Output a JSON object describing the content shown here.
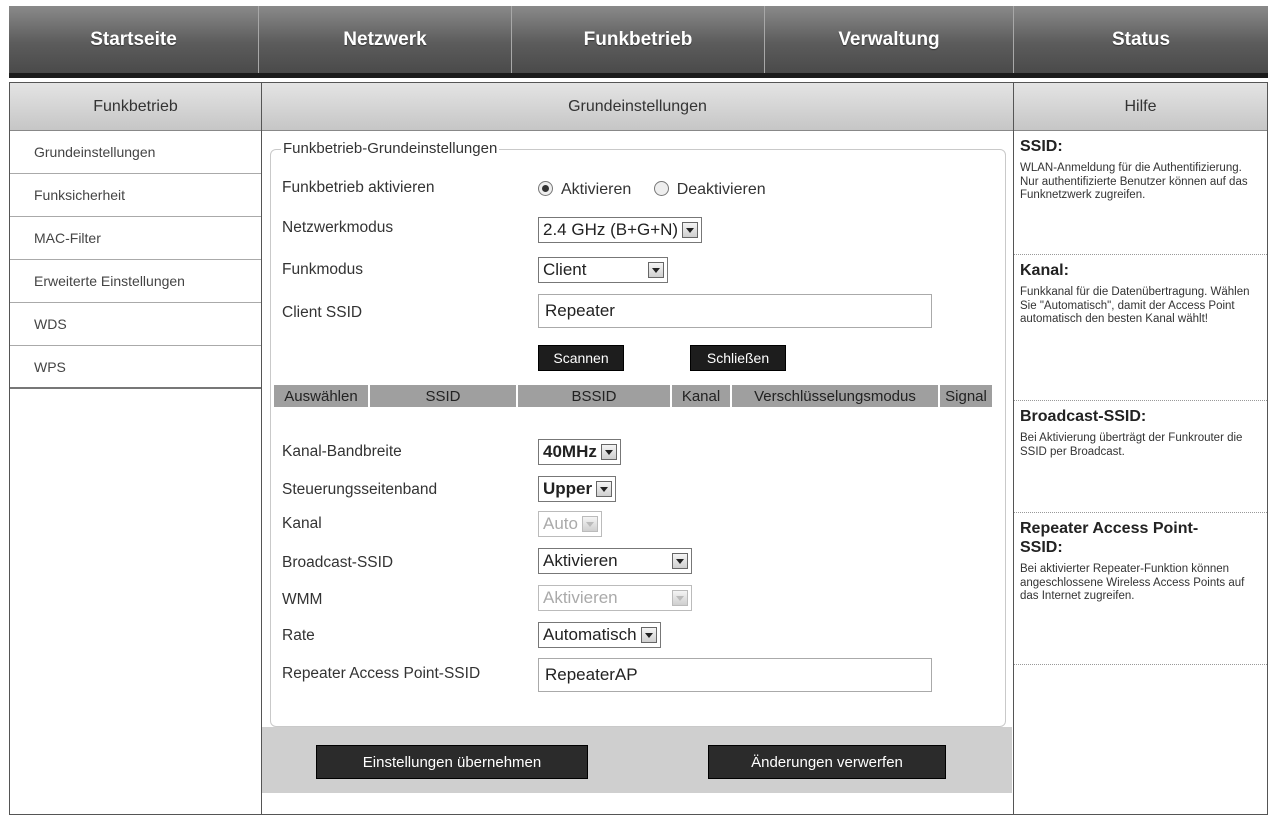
{
  "topnav": [
    "Startseite",
    "Netzwerk",
    "Funkbetrieb",
    "Verwaltung",
    "Status"
  ],
  "sidebar": {
    "title": "Funkbetrieb",
    "items": [
      "Grundeinstellungen",
      "Funksicherheit",
      "MAC-Filter",
      "Erweiterte Einstellungen",
      "WDS",
      "WPS"
    ]
  },
  "main": {
    "title": "Grundeinstellungen",
    "legend": "Funkbetrieb-Grundeinstellungen",
    "enable": {
      "label": "Funkbetrieb aktivieren",
      "opt_on": "Aktivieren",
      "opt_off": "Deaktivieren",
      "selected": "Aktivieren"
    },
    "netmode": {
      "label": "Netzwerkmodus",
      "value": "2.4 GHz (B+G+N)"
    },
    "radiomode": {
      "label": "Funkmodus",
      "value": "Client"
    },
    "client_ssid": {
      "label": "Client SSID",
      "value": "Repeater"
    },
    "scan_button": "Scannen",
    "close_button": "Schließen",
    "scan_columns": [
      "Auswählen",
      "SSID",
      "BSSID",
      "Kanal",
      "Verschlüsselungsmodus",
      "Signal"
    ],
    "bandwidth": {
      "label": "Kanal-Bandbreite",
      "value": "40MHz"
    },
    "sideband": {
      "label": "Steuerungsseitenband",
      "value": "Upper"
    },
    "channel": {
      "label": "Kanal",
      "value": "Auto"
    },
    "broadcast": {
      "label": "Broadcast-SSID",
      "value": "Aktivieren"
    },
    "wmm": {
      "label": "WMM",
      "value": "Aktivieren"
    },
    "rate": {
      "label": "Rate",
      "value": "Automatisch"
    },
    "repeater_ap": {
      "label": "Repeater Access Point-SSID",
      "value": "RepeaterAP"
    },
    "apply_button": "Einstellungen übernehmen",
    "discard_button": "Änderungen verwerfen"
  },
  "help": {
    "title": "Hilfe",
    "sections": [
      {
        "heading": "SSID:",
        "text": "WLAN-Anmeldung für die Authentifizierung. Nur authentifizierte Benutzer können auf das Funknetzwerk zugreifen."
      },
      {
        "heading": "Kanal:",
        "text": "Funkkanal für die Datenübertragung. Wählen Sie \"Automatisch\", damit der Access Point automatisch den besten Kanal wählt!"
      },
      {
        "heading": "Broadcast-SSID:",
        "text": "Bei Aktivierung überträgt der Funkrouter die SSID per Broadcast."
      },
      {
        "heading": "Repeater Access Point-SSID:",
        "text": "Bei aktivierter Repeater-Funktion können angeschlossene Wireless Access Points auf das Internet zugreifen."
      }
    ]
  }
}
